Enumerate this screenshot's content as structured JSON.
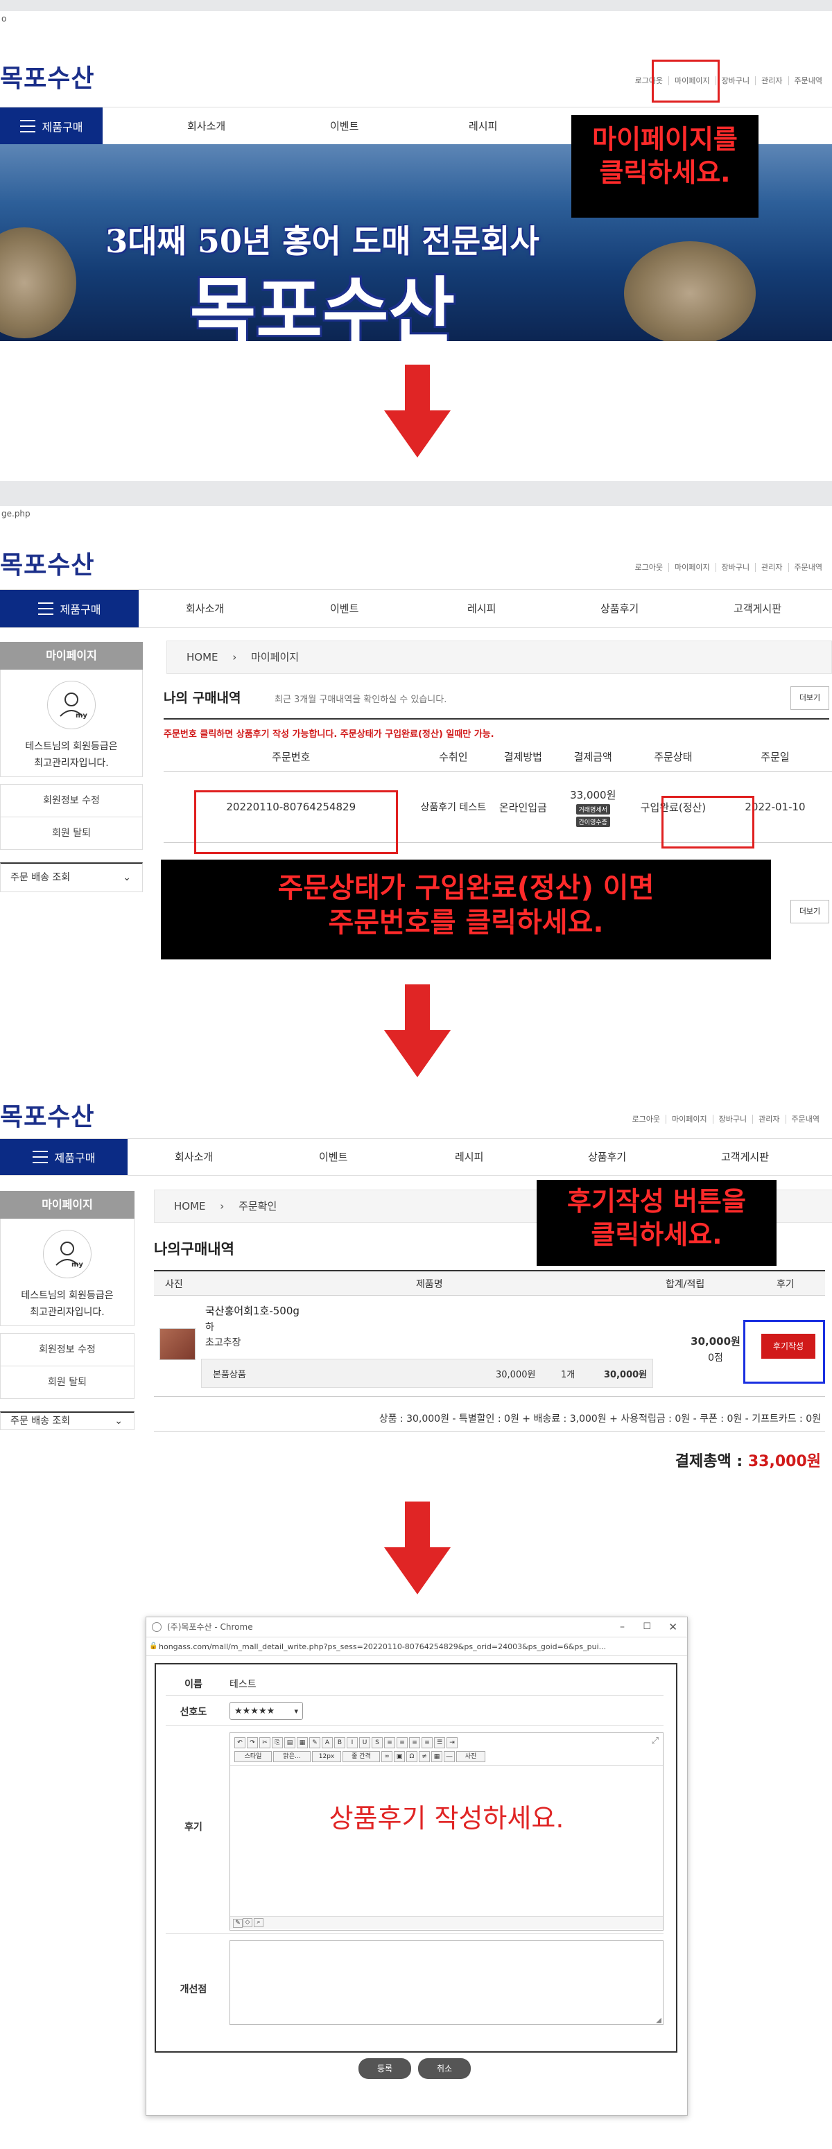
{
  "panel1": {
    "address": "o",
    "logo": "목포수산",
    "util_links": [
      "로그아웃",
      "마이페이지",
      "장바구니",
      "관리자",
      "주문내역"
    ],
    "menu_button": "제품구매",
    "nav": [
      "회사소개",
      "이벤트",
      "레시피"
    ],
    "hero_sub": "3대째 50년 홍어 도매 전문회사",
    "hero_title": "목포수산",
    "callout": [
      "마이페이지를",
      "클릭하세요."
    ]
  },
  "panel2": {
    "address": "ge.php",
    "logo": "목포수산",
    "util_links": [
      "로그아웃",
      "마이페이지",
      "장바구니",
      "관리자",
      "주문내역"
    ],
    "menu_button": "제품구매",
    "nav": [
      "회사소개",
      "이벤트",
      "레시피",
      "상품후기",
      "고객게시판"
    ],
    "sidebar": {
      "title": "마이페이지",
      "avatar_label": "my",
      "member_line1": "테스트님의 회원등급은",
      "member_line2": "최고관리자입니다.",
      "links": [
        "회원정보 수정",
        "회원 탈퇴"
      ],
      "delivery": "주문 배송 조회"
    },
    "breadcrumb": [
      "HOME",
      "마이페이지"
    ],
    "section_title": "나의 구매내역",
    "section_desc": "최근 3개월 구매내역을 확인하실 수 있습니다.",
    "more_button": "더보기",
    "notice": "주문번호 클릭하면 상품후기 작성 가능합니다. 주문상태가 구입완료(정산) 일때만 가능.",
    "columns": [
      "주문번호",
      "수취인",
      "결제방법",
      "결제금액",
      "주문상태",
      "주문일"
    ],
    "row": {
      "order_no": "20220110-80764254829",
      "receiver": "상품후기 테스트",
      "method": "온라인입금",
      "amount": "33,000원",
      "badge1": "거래명세서",
      "badge2": "간이영수증",
      "status": "구입완료(정산)",
      "date": "2022-01-10"
    },
    "callout": [
      "주문상태가 구입완료(정산) 이면",
      "주문번호를 클릭하세요."
    ]
  },
  "panel3": {
    "logo": "목포수산",
    "util_links": [
      "로그아웃",
      "마이페이지",
      "장바구니",
      "관리자",
      "주문내역"
    ],
    "menu_button": "제품구매",
    "nav": [
      "회사소개",
      "이벤트",
      "레시피",
      "상품후기",
      "고객게시판"
    ],
    "sidebar": {
      "title": "마이페이지",
      "avatar_label": "my",
      "member_line1": "테스트님의 회원등급은",
      "member_line2": "최고관리자입니다.",
      "links": [
        "회원정보 수정",
        "회원 탈퇴"
      ],
      "delivery": "주문 배송 조회"
    },
    "breadcrumb": [
      "HOME",
      "주문확인"
    ],
    "section_title": "나의구매내역",
    "columns": [
      "사진",
      "제품명",
      "합계/적립",
      "후기"
    ],
    "product": {
      "name": "국산홍어회1호-500g",
      "option1": "하",
      "option2": "초고추장",
      "sub_label": "본품상품",
      "sub_price": "30,000원",
      "sub_qty": "1개",
      "sub_total": "30,000원",
      "total": "30,000원",
      "points": "0점",
      "review_button": "후기작성"
    },
    "summary": "상품 : 30,000원 - 특별할인 : 0원 + 배송료 : 3,000원 + 사용적립금 : 0원 - 쿠폰 : 0원 - 기프트카드 : 0원",
    "grand_label": "결제총액 : ",
    "grand_value": "33,000원",
    "callout": [
      "후기작성 버튼을",
      "클릭하세요."
    ]
  },
  "panel4": {
    "window_title": "(주)목포수산 - Chrome",
    "url": "hongass.com/mall/m_mall_detail_write.php?ps_sess=20220110-80764254829&ps_orid=24003&ps_goid=6&ps_pui...",
    "name_label": "이름",
    "name_value": "테스트",
    "pref_label": "선호도",
    "pref_value": "★★★★★",
    "review_label": "후기",
    "toolbar_row2": [
      "스타일",
      "맑은...",
      "12px",
      "줄 간격",
      "사진"
    ],
    "review_hint": "상품후기 작성하세요.",
    "improve_label": "개선점",
    "submit": "등록",
    "cancel": "취소"
  },
  "colors": {
    "brand": "#0b2b85",
    "callout_text": "#ff2a2a",
    "callout_bg": "#000000",
    "arrow": "#e02525",
    "review_button": "#d11a1a"
  },
  "icons": [
    "hamburger-icon",
    "user-icon",
    "chevron-down-icon",
    "arrow-down-icon",
    "lock-icon",
    "close-icon",
    "minimize-icon",
    "maximize-icon",
    "resize-icon"
  ]
}
